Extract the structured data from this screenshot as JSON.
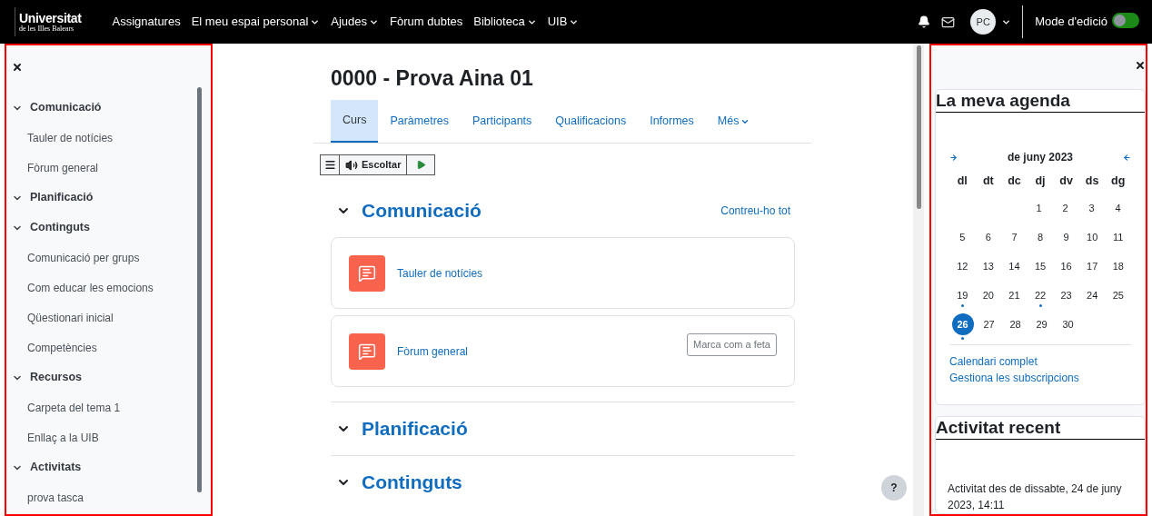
{
  "navbar": {
    "logo": {
      "title": "Universitat",
      "subtitle": "de les Illes Balears"
    },
    "menu": [
      {
        "label": "Assignatures",
        "dropdown": false
      },
      {
        "label": "El meu espai personal",
        "dropdown": true
      },
      {
        "label": "Ajudes",
        "dropdown": true
      },
      {
        "label": "Fòrum dubtes",
        "dropdown": false
      },
      {
        "label": "Biblioteca",
        "dropdown": true
      },
      {
        "label": "UIB",
        "dropdown": true
      }
    ],
    "avatar": "PC",
    "edit_mode": {
      "label": "Mode d'edició",
      "on": false
    }
  },
  "course_index": {
    "sections": [
      {
        "title": "Comunicació",
        "expanded": true,
        "children": [
          {
            "title": "Tauler de notícies"
          },
          {
            "title": "Fòrum general"
          }
        ]
      },
      {
        "title": "Planificació",
        "expanded": true
      },
      {
        "title": "Continguts",
        "expanded": true,
        "children": [
          {
            "title": "Comunicació per grups"
          },
          {
            "title": "Com educar les emocions"
          },
          {
            "title": "Qüestionari inicial"
          },
          {
            "title": "Competències"
          }
        ]
      },
      {
        "title": "Recursos",
        "expanded": true,
        "children": [
          {
            "title": "Carpeta del tema 1"
          },
          {
            "title": "Enllaç a la UIB"
          }
        ]
      },
      {
        "title": "Activitats",
        "expanded": true,
        "children": [
          {
            "title": "prova tasca"
          }
        ]
      }
    ]
  },
  "course": {
    "title": "0000 - Prova Aina 01",
    "tabs": [
      {
        "label": "Curs",
        "selected": true,
        "dropdown": false
      },
      {
        "label": "Paràmetres",
        "selected": false,
        "dropdown": false
      },
      {
        "label": "Participants",
        "selected": false,
        "dropdown": false
      },
      {
        "label": "Qualificacions",
        "selected": false,
        "dropdown": false
      },
      {
        "label": "Informes",
        "selected": false,
        "dropdown": false
      },
      {
        "label": "Més",
        "selected": false,
        "dropdown": true
      }
    ],
    "listen_button": "Escoltar",
    "collapse_all": "Contreu-ho tot",
    "sections": [
      {
        "title": "Comunicació",
        "expanded": true,
        "activities": [
          {
            "title": "Tauler de notícies"
          },
          {
            "title": "Fòrum general",
            "completion_button": "Marca com a feta"
          }
        ]
      },
      {
        "title": "Planificació",
        "expanded": true
      },
      {
        "title": "Continguts",
        "expanded": true
      }
    ]
  },
  "help_button": "?",
  "blocks": {
    "calendar": {
      "title": "La meva agenda",
      "month": "de juny 2023",
      "weekdays": [
        "dl",
        "dt",
        "dc",
        "dj",
        "dv",
        "ds",
        "dg"
      ],
      "weeks": [
        {
          "kind": "trailing",
          "days": [
            {
              "day": "1",
              "today": false,
              "events": false
            },
            {
              "day": "2",
              "today": false,
              "events": false
            },
            {
              "day": "3",
              "today": false,
              "events": false
            },
            {
              "day": "4",
              "today": false,
              "events": false
            }
          ]
        },
        {
          "kind": "full",
          "days": [
            {
              "day": "5",
              "today": false,
              "events": false
            },
            {
              "day": "6",
              "today": false,
              "events": false
            },
            {
              "day": "7",
              "today": false,
              "events": false
            },
            {
              "day": "8",
              "today": false,
              "events": false
            },
            {
              "day": "9",
              "today": false,
              "events": false
            },
            {
              "day": "10",
              "today": false,
              "events": false
            },
            {
              "day": "11",
              "today": false,
              "events": false
            }
          ]
        },
        {
          "kind": "full",
          "days": [
            {
              "day": "12",
              "today": false,
              "events": false
            },
            {
              "day": "13",
              "today": false,
              "events": false
            },
            {
              "day": "14",
              "today": false,
              "events": false
            },
            {
              "day": "15",
              "today": false,
              "events": false
            },
            {
              "day": "16",
              "today": false,
              "events": false
            },
            {
              "day": "17",
              "today": false,
              "events": false
            },
            {
              "day": "18",
              "today": false,
              "events": false
            }
          ]
        },
        {
          "kind": "full",
          "days": [
            {
              "day": "19",
              "today": false,
              "events": true
            },
            {
              "day": "20",
              "today": false,
              "events": false
            },
            {
              "day": "21",
              "today": false,
              "events": false
            },
            {
              "day": "22",
              "today": false,
              "events": true
            },
            {
              "day": "23",
              "today": false,
              "events": false
            },
            {
              "day": "24",
              "today": false,
              "events": false
            },
            {
              "day": "25",
              "today": false,
              "events": false
            }
          ]
        },
        {
          "kind": "leading",
          "days": [
            {
              "day": "26",
              "today": true,
              "events": true
            },
            {
              "day": "27",
              "today": false,
              "events": false
            },
            {
              "day": "28",
              "today": false,
              "events": false
            },
            {
              "day": "29",
              "today": false,
              "events": false
            },
            {
              "day": "30",
              "today": false,
              "events": false
            }
          ]
        }
      ],
      "links": [
        "Calendari complet",
        "Gestiona les subscripcions"
      ]
    },
    "recent_activity": {
      "title": "Activitat recent",
      "text": "Activitat des de dissabte, 24 de juny 2023, 14:11"
    }
  }
}
